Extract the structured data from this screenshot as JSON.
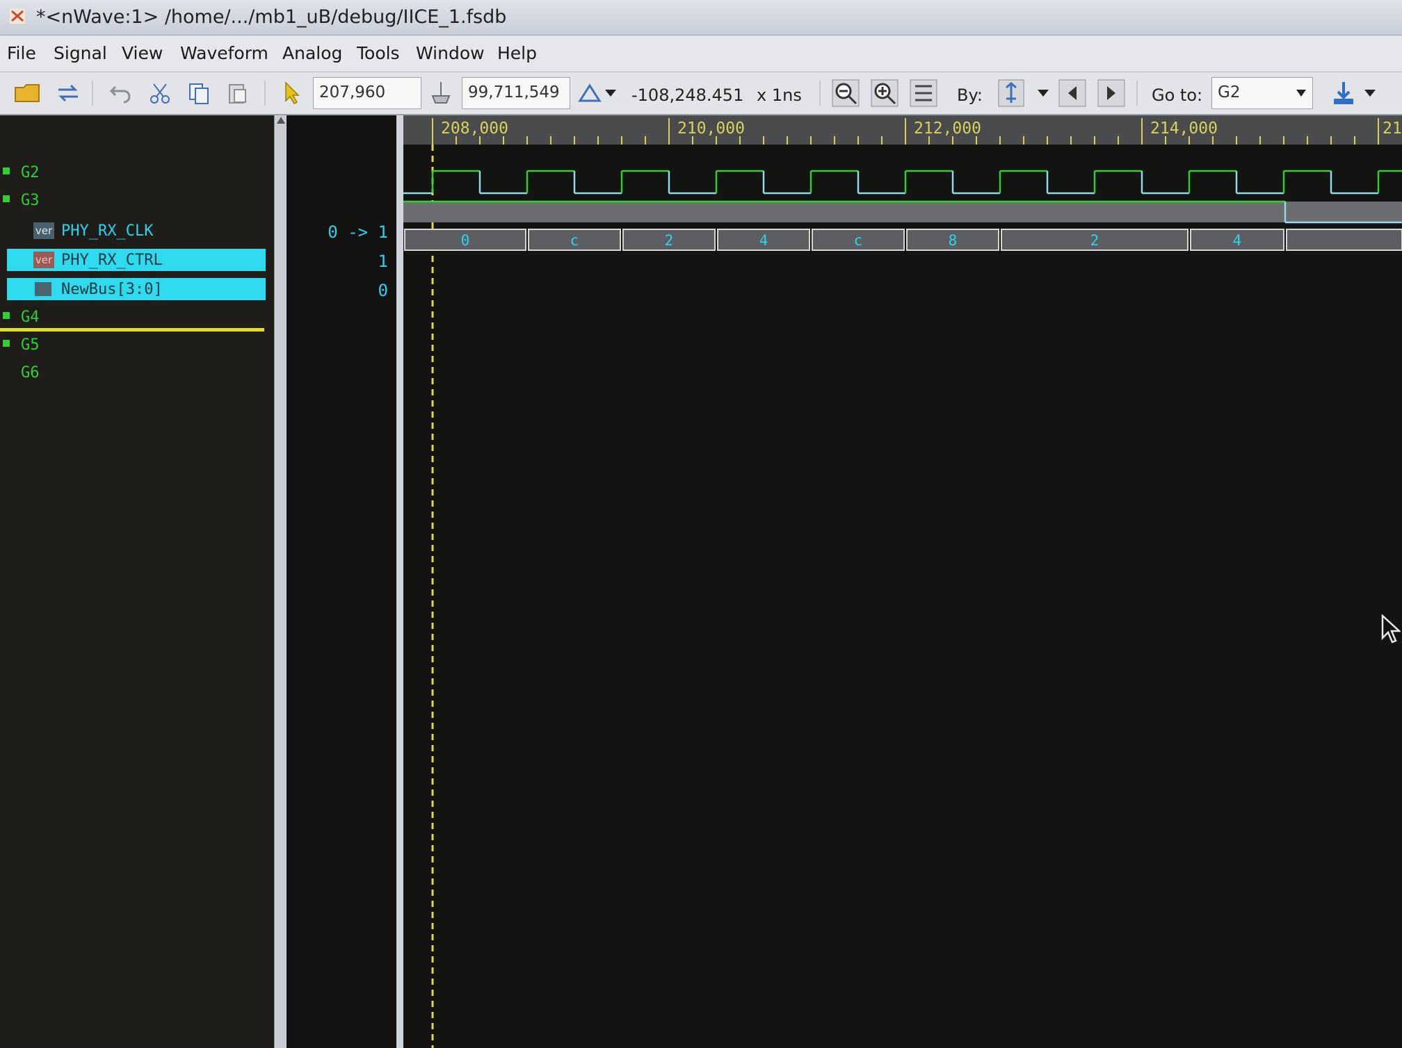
{
  "window": {
    "title": "*<nWave:1> /home/.../mb1_uB/debug/IICE_1.fsdb"
  },
  "menu": [
    "File",
    "Signal",
    "View",
    "Waveform",
    "Analog",
    "Tools",
    "Window",
    "Help"
  ],
  "toolbar": {
    "cursor_time": "207,960",
    "marker_time": "99,711,549",
    "delta_time": "-108,248.451",
    "time_unit": "x 1ns",
    "by_label": "By:",
    "goto_label": "Go to:",
    "goto_value": "G2"
  },
  "signals": {
    "groups": [
      "G2",
      "G3",
      "G4",
      "G5",
      "G6"
    ],
    "phy_rx_clk": "PHY_RX_CLK",
    "phy_rx_ctrl": "PHY_RX_CTRL",
    "newbus": "NewBus[3:0]",
    "ver_badge": "ver"
  },
  "values": {
    "clk": "0 -> 1",
    "ctrl": "1",
    "bus": "0"
  },
  "ruler": {
    "labels": [
      "208,000",
      "210,000",
      "212,000",
      "214,000",
      "21"
    ]
  },
  "bus_values": [
    "0",
    "c",
    "2",
    "4",
    "c",
    "8",
    "2",
    "4"
  ],
  "colors": {
    "clk_high": "#2fd02f",
    "clk_low": "#8fd9e8",
    "signal_name": "#2bd3ee",
    "selection": "#2fd9ee",
    "group": "#2fd02f",
    "ruler_label": "#d8d25a",
    "cursor_line": "#e6d84a"
  },
  "icons": [
    "open-folder-icon",
    "reload-icon",
    "undo-icon",
    "cut-icon",
    "copy-icon",
    "paste-icon",
    "pointer-icon",
    "marker-icon",
    "delta-icon",
    "zoom-out-icon",
    "zoom-in-icon",
    "zoom-fit-icon",
    "search-by-icon",
    "previous-icon",
    "next-icon",
    "dropdown-icon",
    "goto-marker-icon"
  ]
}
